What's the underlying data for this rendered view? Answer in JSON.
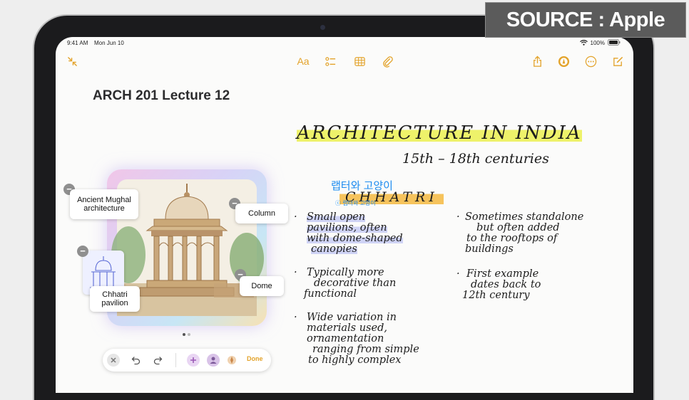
{
  "badge": {
    "source": "SOURCE : Apple"
  },
  "status": {
    "time": "9:41 AM",
    "date": "Mon Jun 10",
    "battery": "100%"
  },
  "toolbar": {
    "font_label": "Aa"
  },
  "note": {
    "title": "ARCH 201 Lecture 12"
  },
  "handwriting": {
    "heading": "ARCHITECTURE IN INDIA",
    "subheading": "15th – 18th centuries",
    "section": "CHHATRI",
    "left_col": [
      [
        "Small open",
        "pavilions, often",
        "with dome-shaped",
        "canopies"
      ],
      [
        "Typically more",
        "decorative than",
        "functional"
      ],
      [
        "Wide variation in",
        "materials used,",
        "ornamentation",
        "ranging from simple",
        "to highly complex"
      ]
    ],
    "right_col": [
      [
        "Sometimes standalone",
        "but often added",
        "to the rooftops of",
        "buildings"
      ],
      [
        "First example",
        "dates back to",
        "12th century"
      ]
    ]
  },
  "image_card": {
    "callouts": {
      "mughal": "Ancient Mughal architecture",
      "column": "Column",
      "dome": "Dome",
      "chhatri": "Chhatri pavilion"
    },
    "pager": {
      "pages": 2,
      "current": 1
    }
  },
  "image_bar": {
    "done_label": "Done"
  },
  "watermark": {
    "line1": "랩터와 고양이",
    "line2": "ⓒ 랩터와 고양이"
  },
  "colors": {
    "accent": "#e3a32b",
    "highlight_yellow": "#eef26a",
    "highlight_orange": "#f6c35c",
    "highlight_blue": "#cfd3f5"
  }
}
